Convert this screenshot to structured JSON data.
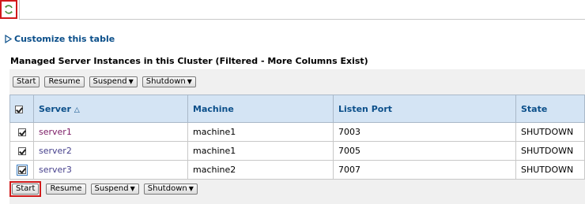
{
  "customize": {
    "label": "Customize this table"
  },
  "table": {
    "title": "Managed Server Instances in this Cluster (Filtered - More Columns Exist)",
    "columns": {
      "server": "Server",
      "machine": "Machine",
      "listen_port": "Listen Port",
      "state": "State"
    },
    "rows": [
      {
        "server": "server1",
        "machine": "machine1",
        "listen_port": "7003",
        "state": "SHUTDOWN",
        "checked": true
      },
      {
        "server": "server2",
        "machine": "machine1",
        "listen_port": "7005",
        "state": "SHUTDOWN",
        "checked": true
      },
      {
        "server": "server3",
        "machine": "machine2",
        "listen_port": "7007",
        "state": "SHUTDOWN",
        "checked": true
      }
    ]
  },
  "toolbar": {
    "start_label": "Start",
    "resume_label": "Resume",
    "suspend_label": "Suspend",
    "shutdown_label": "Shutdown"
  },
  "icons": {
    "refresh": "refresh-icon",
    "expand": "triangle-right-icon",
    "sort": "sort-ascending-icon"
  },
  "colors": {
    "highlight": "#d11a1a",
    "header_bg": "#d4e4f4",
    "link": "#0b4f8a"
  }
}
